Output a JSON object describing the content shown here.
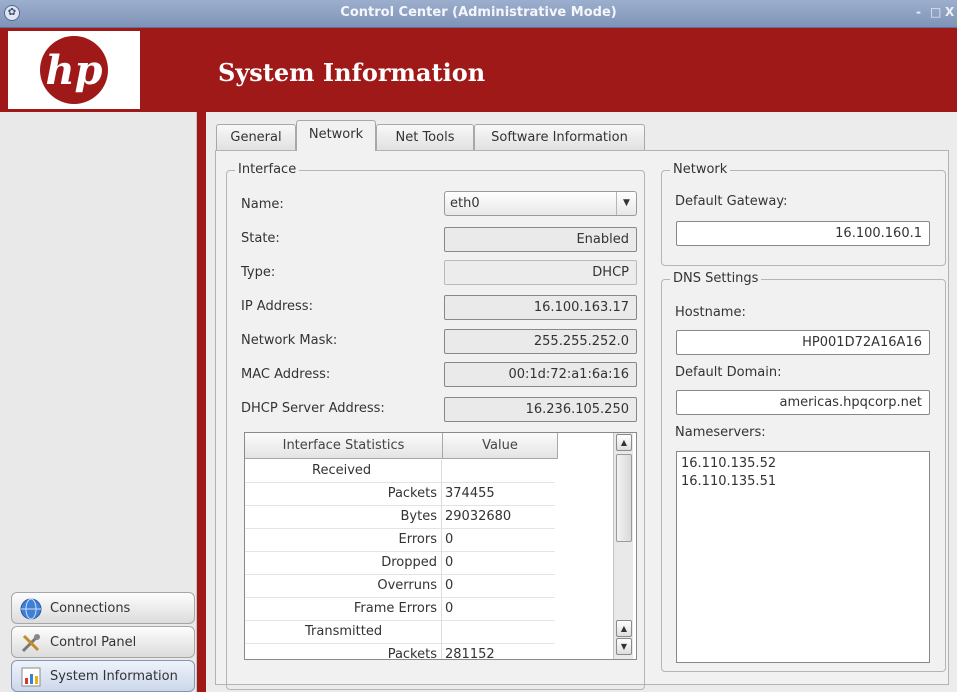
{
  "window": {
    "title": "Control Center (Administrative Mode)",
    "controls": [
      "-",
      "□",
      "X"
    ]
  },
  "header": {
    "logo_text": "hp",
    "title": "System Information"
  },
  "sidebar": {
    "items": [
      {
        "label": "Connections",
        "icon": "globe-icon"
      },
      {
        "label": "Control Panel",
        "icon": "tools-icon"
      },
      {
        "label": "System Information",
        "icon": "chart-icon",
        "active": true
      }
    ]
  },
  "tabs": [
    {
      "label": "General"
    },
    {
      "label": "Network",
      "active": true
    },
    {
      "label": "Net Tools"
    },
    {
      "label": "Software Information"
    }
  ],
  "interface": {
    "group_title": "Interface",
    "name_label": "Name:",
    "name_value": "eth0",
    "state_label": "State:",
    "state_value": "Enabled",
    "type_label": "Type:",
    "type_value": "DHCP",
    "ip_label": "IP Address:",
    "ip_value": "16.100.163.17",
    "mask_label": "Network Mask:",
    "mask_value": "255.255.252.0",
    "mac_label": "MAC Address:",
    "mac_value": "00:1d:72:a1:6a:16",
    "dhcp_label": "DHCP Server Address:",
    "dhcp_value": "16.236.105.250"
  },
  "stats": {
    "col1": "Interface Statistics",
    "col2": "Value",
    "rows": [
      {
        "name": "Received",
        "value": ""
      },
      {
        "name": "Packets",
        "value": "374455"
      },
      {
        "name": "Bytes",
        "value": "29032680"
      },
      {
        "name": "Errors",
        "value": "0"
      },
      {
        "name": "Dropped",
        "value": "0"
      },
      {
        "name": "Overruns",
        "value": "0"
      },
      {
        "name": "Frame Errors",
        "value": "0"
      },
      {
        "name": "Transmitted",
        "value": ""
      },
      {
        "name": "Packets",
        "value": "281152"
      }
    ]
  },
  "network": {
    "group_title": "Network",
    "gateway_label": "Default Gateway:",
    "gateway_value": "16.100.160.1"
  },
  "dns": {
    "group_title": "DNS Settings",
    "hostname_label": "Hostname:",
    "hostname_value": "HP001D72A16A16",
    "domain_label": "Default Domain:",
    "domain_value": "americas.hpqcorp.net",
    "nameservers_label": "Nameservers:",
    "nameservers": [
      "16.110.135.52",
      "16.110.135.51"
    ]
  },
  "colors": {
    "brand_red": "#a01919",
    "titlebar": "#8fa2c4"
  }
}
